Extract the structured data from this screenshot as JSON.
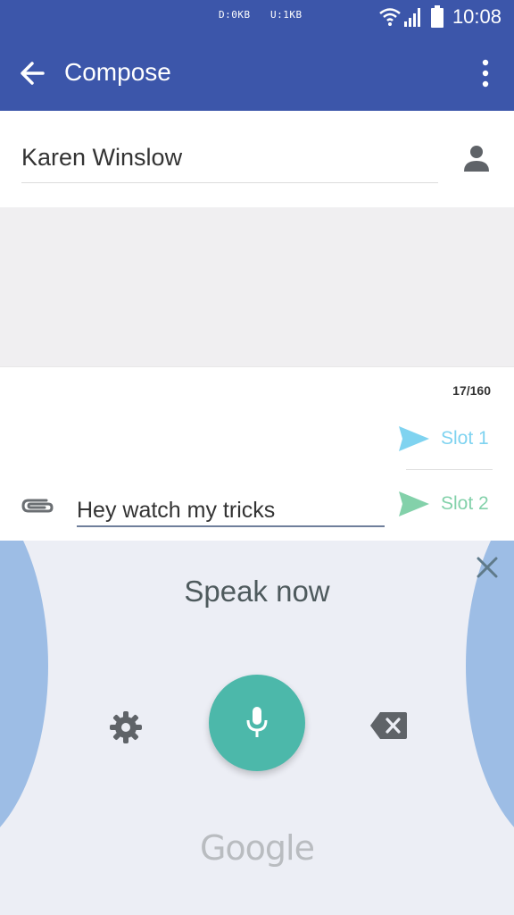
{
  "status_bar": {
    "download": "D:0KB",
    "upload": "U:1KB",
    "time": "10:08"
  },
  "app_bar": {
    "title": "Compose"
  },
  "recipient": {
    "name": "Karen Winslow"
  },
  "composer": {
    "char_count": "17/160",
    "message": "Hey watch my tricks",
    "slots": [
      {
        "label": "Slot 1",
        "color": "#7fd3f0"
      },
      {
        "label": "Slot 2",
        "color": "#83d1aa"
      }
    ]
  },
  "voice_input": {
    "prompt": "Speak now",
    "brand": "Google",
    "mic_color": "#4cb8aa"
  },
  "icons": [
    "back-arrow-icon",
    "overflow-menu-icon",
    "person-icon",
    "send-icon",
    "paperclip-icon",
    "close-icon",
    "gear-icon",
    "microphone-icon",
    "backspace-icon",
    "wifi-icon",
    "signal-icon",
    "battery-icon"
  ]
}
